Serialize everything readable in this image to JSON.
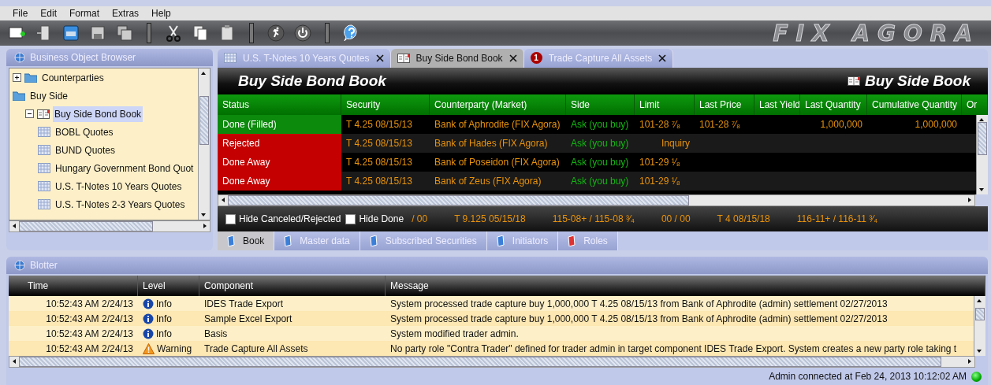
{
  "menu": [
    "File",
    "Edit",
    "Format",
    "Extras",
    "Help"
  ],
  "logo": "FIX AGORA",
  "browser": {
    "title": "Business Object Browser",
    "items": [
      {
        "label": "Counterparties",
        "kind": "folder",
        "expanded": false,
        "selected": false
      },
      {
        "label": "Buy Side",
        "kind": "folder",
        "selected": false,
        "children": [
          {
            "label": "Buy Side Bond Book",
            "kind": "book",
            "expanded": true,
            "selected": true,
            "children": [
              {
                "label": "BOBL Quotes",
                "kind": "quotes",
                "selected": false
              },
              {
                "label": "BUND Quotes",
                "kind": "quotes",
                "selected": false
              },
              {
                "label": "Hungary Government Bond Quot",
                "kind": "quotes",
                "selected": false
              },
              {
                "label": "U.S. T-Notes 10 Years Quotes",
                "kind": "quotes",
                "selected": false
              },
              {
                "label": "U.S. T-Notes 2-3 Years Quotes",
                "kind": "quotes",
                "selected": false
              }
            ]
          }
        ]
      }
    ]
  },
  "doc_tabs": [
    {
      "label": "U.S. T-Notes 10 Years Quotes",
      "kind": "quotes",
      "selected": false
    },
    {
      "label": "Buy Side Bond Book",
      "kind": "book",
      "selected": true
    },
    {
      "label": "Trade Capture All Assets",
      "kind": "alert",
      "badge": "1",
      "selected": false
    }
  ],
  "book": {
    "title": "Buy Side Bond Book",
    "subtitle": "Buy Side Book",
    "columns": [
      "Status",
      "Security",
      "Counterparty (Market)",
      "Side",
      "Limit",
      "Last Price",
      "Last Yield",
      "Last Quantity",
      "Cumulative Quantity",
      "Or"
    ],
    "rows": [
      {
        "status": "Done (Filled)",
        "color": "#0b8a0b",
        "security": "T 4.25 08/15/13",
        "counterparty": "Bank of Aphrodite (FIX Agora)",
        "side": "Ask (you buy)",
        "limit": "101-28 ⁷⁄₈",
        "last_price": "101-28 ⁷⁄₈",
        "last_quantity": "1,000,000",
        "cumulative_quantity": "1,000,000"
      },
      {
        "status": "Rejected",
        "color": "#c40000",
        "security": "T 4.25 08/15/13",
        "counterparty": "Bank of Hades (FIX Agora)",
        "side": "Ask (you buy)",
        "limit": "Inquiry"
      },
      {
        "status": "Done Away",
        "color": "#c40000",
        "security": "T 4.25 08/15/13",
        "counterparty": "Bank of Poseidon (FIX Agora)",
        "side": "Ask (you buy)",
        "limit": "101-29 ¹⁄₈"
      },
      {
        "status": "Done Away",
        "color": "#c40000",
        "security": "T 4.25 08/15/13",
        "counterparty": "Bank of Zeus (FIX Agora)",
        "side": "Ask (you buy)",
        "limit": "101-29 ¹⁄₈"
      }
    ],
    "filters": [
      {
        "label": "Hide Canceled/Rejected",
        "checked": false
      },
      {
        "label": "Hide Done",
        "checked": false
      }
    ],
    "ticker": [
      "/ 00",
      "T 9.125 05/15/18",
      "115-08+ / 115-08 ³⁄₄",
      "00 / 00",
      "T 4 08/15/18",
      "116-11+ / 116-11 ³⁄₄"
    ],
    "tabs": [
      {
        "label": "Book",
        "kind": "blue",
        "selected": true
      },
      {
        "label": "Master data",
        "kind": "blue",
        "selected": false
      },
      {
        "label": "Subscribed Securities",
        "kind": "blue",
        "selected": false
      },
      {
        "label": "Initiators",
        "kind": "blue",
        "selected": false
      },
      {
        "label": "Roles",
        "kind": "red",
        "selected": false
      }
    ]
  },
  "blotter": {
    "title": "Blotter",
    "columns": [
      "Time",
      "Level",
      "Component",
      "Message"
    ],
    "rows": [
      {
        "time": "10:52:43 AM 2/24/13",
        "level": "Info",
        "kind": "info",
        "component": "IDES Trade Export",
        "message": "System processed trade capture buy 1,000,000 T 4.25 08/15/13 from Bank of Aphrodite (admin) settlement 02/27/2013"
      },
      {
        "time": "10:52:43 AM 2/24/13",
        "level": "Info",
        "kind": "info",
        "component": "Sample Excel Export",
        "message": "System processed trade capture buy 1,000,000 T 4.25 08/15/13 from Bank of Aphrodite (admin) settlement 02/27/2013"
      },
      {
        "time": "10:52:43 AM 2/24/13",
        "level": "Info",
        "kind": "info",
        "component": "Basis",
        "message": "System modified trader admin."
      },
      {
        "time": "10:52:43 AM 2/24/13",
        "level": "Warning",
        "kind": "warning",
        "component": "Trade Capture All Assets",
        "message": "No party role \"Contra Trader\" defined for trader admin in target component IDES Trade Export. System creates a new party role taking t"
      }
    ]
  },
  "status_bar": {
    "text": "Admin connected at Feb 24, 2013 10:12:02 AM",
    "connected": true
  }
}
